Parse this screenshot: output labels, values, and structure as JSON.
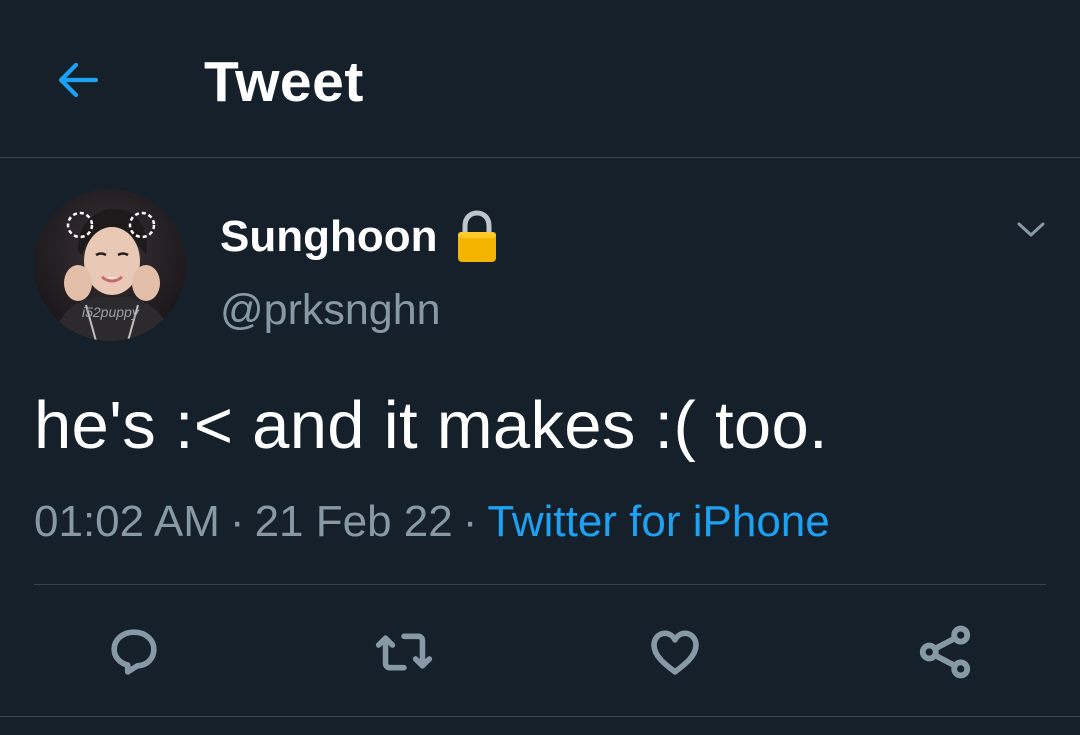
{
  "header": {
    "title": "Tweet",
    "back_icon": "back-arrow-icon"
  },
  "colors": {
    "background": "#15202b",
    "accent": "#1da1f2",
    "secondary_text": "#8899a6",
    "divider": "#38444d",
    "lock": "#f5b400"
  },
  "author": {
    "display_name": "Sunghoon",
    "handle": "@prksnghn",
    "badge_icon": "lock-icon",
    "menu_icon": "chevron-down-icon",
    "avatar_watermark": "i52puppy"
  },
  "tweet": {
    "text": "he's :< and it makes :( too.",
    "time": "01:02 AM",
    "date": "21 Feb 22",
    "separator": "·",
    "source": "Twitter for iPhone"
  },
  "actions": [
    {
      "name": "reply",
      "icon": "reply-icon"
    },
    {
      "name": "retweet",
      "icon": "retweet-icon"
    },
    {
      "name": "like",
      "icon": "heart-icon"
    },
    {
      "name": "share",
      "icon": "share-icon"
    }
  ]
}
